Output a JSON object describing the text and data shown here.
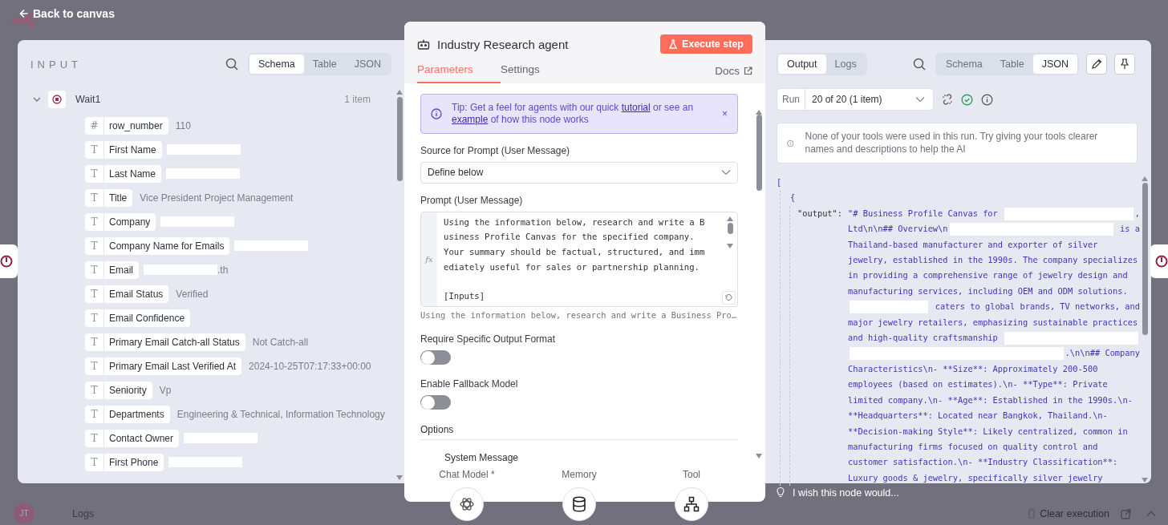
{
  "top_bar": {
    "back_link": "Back to canvas"
  },
  "input_panel": {
    "title": "INPUT",
    "view_tabs": [
      {
        "label": "Schema",
        "selected": true
      },
      {
        "label": "Table",
        "selected": false
      },
      {
        "label": "JSON",
        "selected": false
      }
    ],
    "node": {
      "name": "Wait1",
      "count": "1 item",
      "expanded": true,
      "fields": [
        {
          "icon": "#",
          "name": "row_number",
          "value": "110"
        },
        {
          "icon": "T",
          "name": "First Name",
          "redacted": true
        },
        {
          "icon": "T",
          "name": "Last Name",
          "redacted": true
        },
        {
          "icon": "T",
          "name": "Title",
          "value": "Vice President Project Management"
        },
        {
          "icon": "T",
          "name": "Company",
          "redacted": true
        },
        {
          "icon": "T",
          "name": "Company Name for Emails",
          "redacted": true
        },
        {
          "icon": "T",
          "name": "Email",
          "redacted": true,
          "value": ".th"
        },
        {
          "icon": "T",
          "name": "Email Status",
          "value": "Verified"
        },
        {
          "icon": "T",
          "name": "Email Confidence"
        },
        {
          "icon": "T",
          "name": "Primary Email Catch-all Status",
          "value": "Not Catch-all"
        },
        {
          "icon": "T",
          "name": "Primary Email Last Verified At",
          "value": "2024-10-25T07:17:33+00:00"
        },
        {
          "icon": "T",
          "name": "Seniority",
          "value": "Vp"
        },
        {
          "icon": "T",
          "name": "Departments",
          "value": "Engineering & Technical, Information Technology"
        },
        {
          "icon": "T",
          "name": "Contact Owner",
          "redacted": true
        },
        {
          "icon": "T",
          "name": "First Phone",
          "redacted": true
        }
      ]
    }
  },
  "node_panel": {
    "title": "Industry Research agent",
    "execute_button": "Execute step",
    "tabs": [
      {
        "label": "Parameters",
        "selected": true
      },
      {
        "label": "Settings",
        "selected": false
      }
    ],
    "docs_link": "Docs",
    "tip": {
      "close": "×",
      "parts": [
        {
          "kind": "text",
          "text": "Tip: Get a feel for agents with our quick "
        },
        {
          "kind": "link",
          "text": "tutorial"
        },
        {
          "kind": "text",
          "text": " or see an "
        },
        {
          "kind": "link",
          "text": "example"
        },
        {
          "kind": "text",
          "text": " of how this node works"
        }
      ]
    },
    "source_label": "Source for Prompt (User Message)",
    "source_value": "Define below",
    "prompt_label": "Prompt (User Message)",
    "prompt_gutter": "fx",
    "prompt_paragraphs": [
      [
        "Using the information below, research and write a B",
        "usiness Profile Canvas for the specified company.",
        "Your summary should be factual, structured, and imm",
        "ediately useful for sales or partnership planning."
      ],
      [
        "[Inputs]"
      ]
    ],
    "prompt_preview": "Using the information below, research and write a Business Pro…",
    "toggles": [
      {
        "label": "Require Specific Output Format",
        "on": false
      },
      {
        "label": "Enable Fallback Model",
        "on": false
      }
    ],
    "options_label": "Options",
    "system_message": "System Message",
    "connectors": [
      {
        "label": "Chat Model *",
        "kind": "model"
      },
      {
        "label": "Memory",
        "kind": "memory"
      },
      {
        "label": "Tool",
        "kind": "tool"
      }
    ]
  },
  "output_panel": {
    "mode_tabs": [
      {
        "label": "Output",
        "selected": true
      },
      {
        "label": "Logs",
        "selected": false
      }
    ],
    "view_tabs": [
      {
        "label": "Schema",
        "selected": false
      },
      {
        "label": "Table",
        "selected": false
      },
      {
        "label": "JSON",
        "selected": true
      }
    ],
    "run_label": "Run",
    "run_value": "20 of 20 (1 item)",
    "notice": "None of your tools were used in this run. Try giving your tools clearer names and descriptions to help the AI",
    "json": {
      "open_bracket": "[",
      "open_brace": "{",
      "key": "\"output\":",
      "lines": [
        [
          {
            "text": "\"# Business Profile Canvas for "
          },
          {
            "redacted": true
          },
          {
            "text": ","
          }
        ],
        [
          {
            "text": "Ltd\\n\\n## Overview\\n"
          },
          {
            "redacted": true
          },
          {
            "text": " is a"
          }
        ],
        [
          {
            "text": "Thailand-based manufacturer and exporter of silver"
          }
        ],
        [
          {
            "text": "jewelry, established in the 1990s. The company specializes"
          }
        ],
        [
          {
            "text": "in providing a comprehensive range of jewelry design and"
          }
        ],
        [
          {
            "text": "manufacturing services, including OEM and ODM solutions."
          }
        ],
        [
          {
            "redacted": true
          },
          {
            "text": " caters to global brands, TV networks, and"
          }
        ],
        [
          {
            "text": "major jewelry retailers, emphasizing sustainable practices"
          }
        ],
        [
          {
            "text": "and high-quality craftsmanship "
          },
          {
            "redacted": true
          }
        ],
        [
          {
            "redacted": true
          },
          {
            "text": ".\\n\\n## Company"
          }
        ],
        [
          {
            "text": "Characteristics\\n- **Size**: Approximately 200-500"
          }
        ],
        [
          {
            "text": "employees (based on estimates).\\n- **Type**: Private"
          }
        ],
        [
          {
            "text": "limited company.\\n- **Age**: Established in the 1990s.\\n-"
          }
        ],
        [
          {
            "text": "**Headquarters**: Located near Bangkok, Thailand.\\n-"
          }
        ],
        [
          {
            "text": "**Decision-making Style**: Likely centralized, common in"
          }
        ],
        [
          {
            "text": "manufacturing firms focused on quality control and"
          }
        ],
        [
          {
            "text": "customer satisfaction.\\n- **Industry Classification**:"
          }
        ],
        [
          {
            "text": "Luxury goods & jewelry, specifically silver jewelry"
          }
        ]
      ]
    },
    "feedback": "I wish this node would..."
  },
  "bottom_bar": {
    "avatar": "JT",
    "logs_label": "Logs",
    "clear_button": "Clear execution"
  }
}
